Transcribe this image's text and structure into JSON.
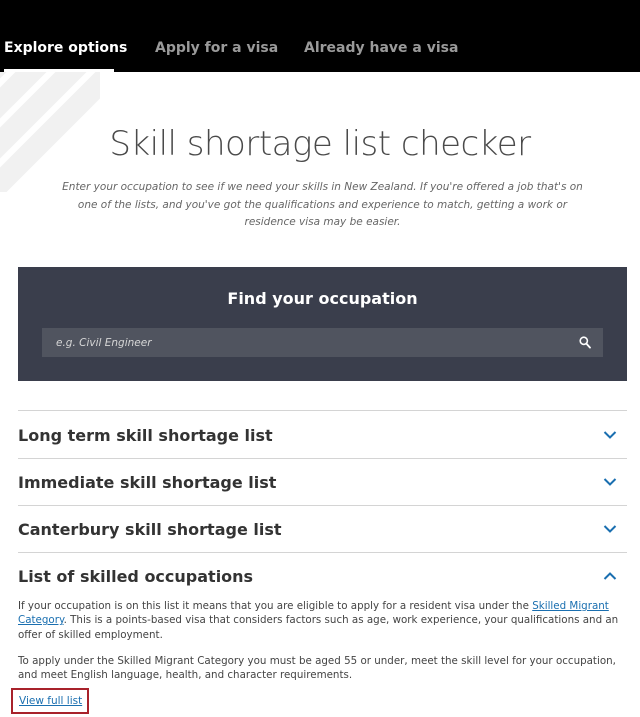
{
  "nav": {
    "tabs": [
      {
        "label": "Explore options",
        "active": true
      },
      {
        "label": "Apply for a visa",
        "active": false
      },
      {
        "label": "Already have a visa",
        "active": false
      }
    ]
  },
  "page": {
    "title": "Skill shortage list checker",
    "intro": "Enter your occupation to see if we need your skills in New Zealand. If you're offered a job that's on one of the lists, and you've got the qualifications and experience to match, getting a work or residence visa may be easier."
  },
  "finder": {
    "title": "Find your occupation",
    "placeholder": "e.g. Civil Engineer",
    "value": ""
  },
  "accordion": {
    "items": [
      {
        "title": "Long term skill shortage list",
        "expanded": false
      },
      {
        "title": "Immediate skill shortage list",
        "expanded": false
      },
      {
        "title": "Canterbury skill shortage list",
        "expanded": false
      },
      {
        "title": "List of skilled occupations",
        "expanded": true
      }
    ],
    "expanded_content": {
      "para1_before": "If your occupation is on this list it means that you are eligible to apply for a resident visa under the ",
      "para1_link": "Skilled Migrant Category",
      "para1_after": ". This is a points-based visa that considers factors such as age, work experience, your qualifications and an offer of skilled employment.",
      "para2": "To apply under the Skilled Migrant Category you must be aged 55 or under, meet the skill level for your occupation, and meet English language, health, and character requirements.",
      "view_full_list": "View full list"
    }
  },
  "colors": {
    "nav_bg": "#000000",
    "finder_bg": "#3a3e4c",
    "search_bg": "#50545f",
    "accent_blue": "#1a6fb0",
    "highlight_red": "#a8222b"
  }
}
